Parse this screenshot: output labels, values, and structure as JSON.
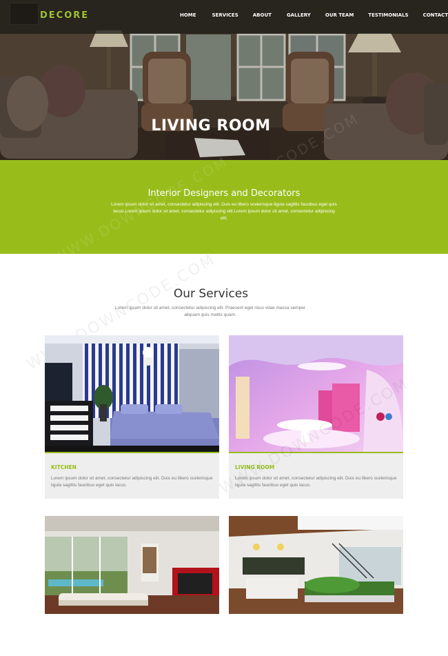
{
  "brand": {
    "logo": "DECORE",
    "accent": "#98bd1b"
  },
  "nav": {
    "items": [
      "HOME",
      "SERVICES",
      "ABOUT",
      "GALLERY",
      "OUR TEAM",
      "TESTIMONIALS",
      "CONTACT"
    ]
  },
  "hero": {
    "title": "LIVING ROOM"
  },
  "band": {
    "title": "Interior Designers and Decorators",
    "text": "Lorem ipsum dolor sit amet, consectetur adipiscing elit. Duis eu libero scelerisque ligula sagittis faucibus eget quis lacus.Lorem ipsum dolor sit amet, consectetur adipiscing elit.Lorem ipsum dolor sit amet, consectetur adipiscing elit."
  },
  "services": {
    "title": "Our Services",
    "subtitle": "Lorem ipsum dolor sit amet, consectetur adipiscing elit. Praesent eget risus vitae massa semper aliquam quis mattis quam.",
    "cards": [
      {
        "title": "KITCHEN",
        "text": "Lorem ipsum dolor sit amet, consectetur adipiscing elit. Duis eu libero scelerisque ligula sagittis faucibus eget quis lacus."
      },
      {
        "title": "LIVING ROOM",
        "text": "Lorem ipsum dolor sit amet, consectetur adipiscing elit. Duis eu libero scelerisque ligula sagittis faucibus eget quis lacus."
      }
    ]
  },
  "watermark": "WWW.DOWNCODE.COM"
}
